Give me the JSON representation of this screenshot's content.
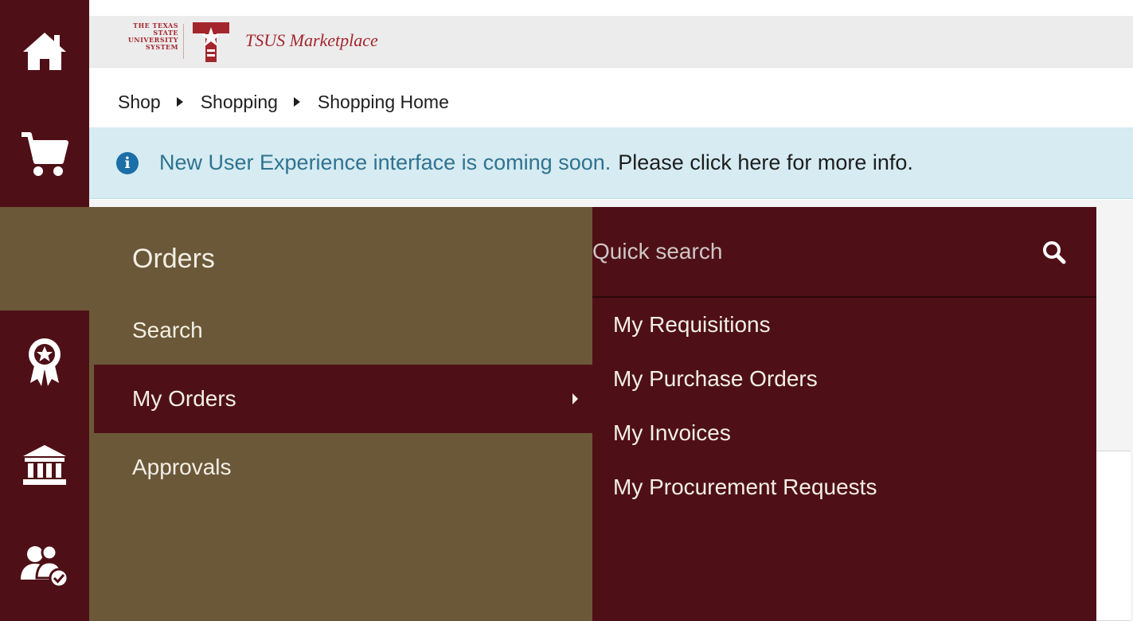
{
  "brand": {
    "org_lines": [
      "THE TEXAS",
      "STATE",
      "UNIVERSITY",
      "SYSTEM"
    ],
    "name": "TSUS Marketplace",
    "color": "#a4262d"
  },
  "colors": {
    "maroon": "#4e1016",
    "gold_brown": "#6b5838",
    "info_blue": "#1b6ea6",
    "banner_bg": "#d6ebf2"
  },
  "rail": {
    "icons": [
      "home-icon",
      "cart-icon",
      "award-ribbon-icon",
      "bank-icon",
      "users-check-icon"
    ]
  },
  "breadcrumb": [
    "Shop",
    "Shopping",
    "Shopping Home"
  ],
  "banner": {
    "message": "New User Experience interface is coming soon.",
    "link": "Please click here for more info."
  },
  "menu": {
    "title": "Orders",
    "items": [
      {
        "label": "Search"
      },
      {
        "label": "My Orders"
      },
      {
        "label": "Approvals"
      }
    ],
    "active_item": "My Orders"
  },
  "submenu": {
    "search_placeholder": "Quick search",
    "items": [
      {
        "label": "My Requisitions"
      },
      {
        "label": "My Purchase Orders"
      },
      {
        "label": "My Invoices"
      },
      {
        "label": "My Procurement Requests"
      }
    ]
  }
}
